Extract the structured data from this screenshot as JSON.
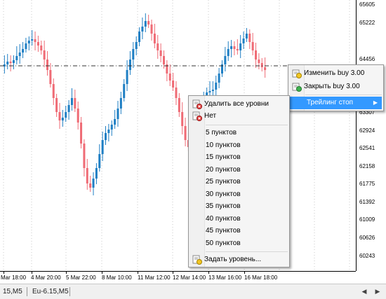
{
  "price_scale": {
    "labels": [
      "65605",
      "65222",
      "64456",
      "63690",
      "63307",
      "62924",
      "62541",
      "62158",
      "61775",
      "61392",
      "61009",
      "60626",
      "60243"
    ]
  },
  "time_axis": {
    "labels": [
      "Mar 18:00",
      "4 Mar 20:00",
      "5 Mar 22:00",
      "8 Mar 10:00",
      "11 Mar 12:00",
      "12 Mar 14:00",
      "13 Mar 16:00",
      "16 Mar 18:00"
    ]
  },
  "tabs": {
    "items": [
      "15,M5",
      "Eu-6.15,M5"
    ]
  },
  "order_menu": {
    "items": [
      {
        "label": "Изменить buy 3.00",
        "icon": "modify-order-icon"
      },
      {
        "label": "Закрыть buy 3.00",
        "icon": "close-order-icon"
      },
      {
        "label": "Трейлинг стоп",
        "icon": "",
        "submenu": true
      }
    ]
  },
  "trailing_menu": {
    "top_items": [
      {
        "label": "Удалить все уровни",
        "icon": "delete-levels-icon"
      },
      {
        "label": "Нет",
        "icon": "none-icon"
      }
    ],
    "levels": [
      "5 пунктов",
      "10 пунктов",
      "15 пунктов",
      "20 пунктов",
      "25 пунктов",
      "30 пунктов",
      "35 пунктов",
      "40 пунктов",
      "45 пунктов",
      "50 пунктов"
    ],
    "custom": {
      "label": "Задать уровень...",
      "icon": "set-level-icon"
    }
  },
  "colors": {
    "bull": "#1f7fc4",
    "bear": "#ef6b75",
    "highlight": "#3399ff"
  }
}
